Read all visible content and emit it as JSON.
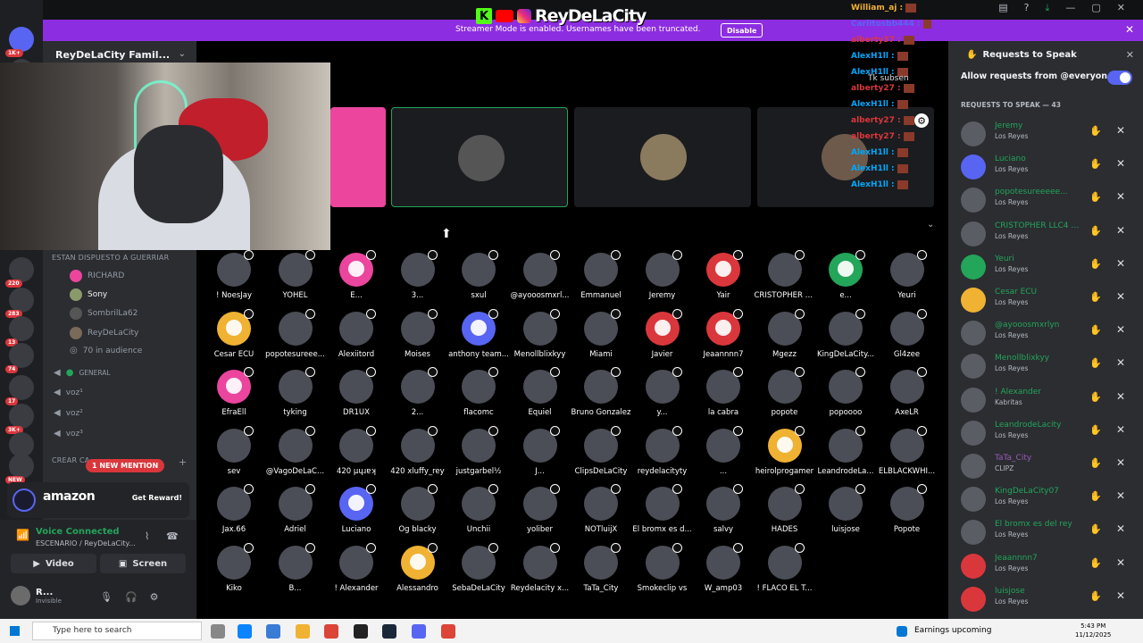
{
  "streamer_banner": {
    "text": "Streamer Mode is enabled. Usernames have been truncated.",
    "button": "Disable"
  },
  "overlay_logo": {
    "k": "K",
    "name": "ReyDeLaCity"
  },
  "chat_overlay": [
    {
      "name": "William_aj",
      "color": "#f0b232"
    },
    {
      "name": "Carlitosbb444",
      "color": "#5865f2"
    },
    {
      "name": "alberty37",
      "color": "#da373c"
    },
    {
      "name": "AlexH1ll",
      "color": "#00a8fc"
    },
    {
      "name": "AlexH1ll",
      "color": "#00a8fc"
    },
    {
      "name": "alberty27",
      "color": "#da373c"
    },
    {
      "name": "AlexH1ll",
      "color": "#00a8fc"
    },
    {
      "name": "alberty27",
      "color": "#da373c"
    },
    {
      "name": "alberty27",
      "color": "#da373c"
    },
    {
      "name": "AlexH1ll",
      "color": "#00a8fc"
    },
    {
      "name": "AlexH1ll",
      "color": "#00a8fc"
    },
    {
      "name": "AlexH1ll",
      "color": "#00a8fc"
    }
  ],
  "chat_tk": "Tk subsen",
  "sidebar": {
    "server_title": "ReyDeLaCity Famil...",
    "server_badges": [
      "1K+",
      "220",
      "283",
      "13",
      "74",
      "17",
      "3K+",
      "NEW"
    ],
    "stage_subtitle": "ESTAN DISPUESTO A GUERRIAR",
    "speakers": [
      "RICHARD",
      "Sony",
      "SombrilLa62",
      "ReyDeLaCity"
    ],
    "audience": "70 in audience",
    "category_general": "GENERAL",
    "voice_channels": [
      "voz¹",
      "voz²",
      "voz³"
    ],
    "crear_label": "CREAR CA",
    "new_mention": "1 NEW MENTION",
    "ad": {
      "brand": "amazon",
      "cta": "Get Reward!"
    },
    "voice": {
      "status": "Voice Connected",
      "channel": "ESCENARIO / ReyDeLaCity...",
      "video": "Video",
      "screen": "Screen"
    },
    "user": {
      "name": "R...",
      "status": "Invisible"
    }
  },
  "stage_tiles": 4,
  "audience_grid": [
    {
      "label": "! NoesJay",
      "kind": "photo"
    },
    {
      "label": "YOHEL",
      "kind": "photo"
    },
    {
      "label": "E...",
      "kind": "pink"
    },
    {
      "label": "3...",
      "kind": "photo"
    },
    {
      "label": "sxul",
      "kind": "photo"
    },
    {
      "label": "@ayooosmxrl...",
      "kind": "photo"
    },
    {
      "label": "Emmanuel",
      "kind": "photo"
    },
    {
      "label": "Jeremy",
      "kind": "photo"
    },
    {
      "label": "Yair",
      "kind": "red"
    },
    {
      "label": "CRISTOPHER LLC...",
      "kind": "photo"
    },
    {
      "label": "e...",
      "kind": "green"
    },
    {
      "label": "Yeuri",
      "kind": "photo"
    },
    {
      "label": "Cesar ECU",
      "kind": "orange"
    },
    {
      "label": "popotesureee...",
      "kind": "photo"
    },
    {
      "label": "Alexiitord",
      "kind": "photo"
    },
    {
      "label": "Moises",
      "kind": "photo"
    },
    {
      "label": "anthony team...",
      "kind": "discord"
    },
    {
      "label": "Menollblixkyy",
      "kind": "photo"
    },
    {
      "label": "Miami",
      "kind": "photo"
    },
    {
      "label": "Javier",
      "kind": "red"
    },
    {
      "label": "Jeaannnn7",
      "kind": "red"
    },
    {
      "label": "Mgezz",
      "kind": "photo"
    },
    {
      "label": "KingDeLaCity...",
      "kind": "photo"
    },
    {
      "label": "Gl4zee",
      "kind": "photo"
    },
    {
      "label": "EfraEll",
      "kind": "pink"
    },
    {
      "label": "tyking",
      "kind": "photo"
    },
    {
      "label": "DR1UX",
      "kind": "photo"
    },
    {
      "label": "2...",
      "kind": "photo"
    },
    {
      "label": "flacomc",
      "kind": "photo"
    },
    {
      "label": "Equiel",
      "kind": "photo"
    },
    {
      "label": "Bruno Gonzalez",
      "kind": "photo"
    },
    {
      "label": "y...",
      "kind": "photo"
    },
    {
      "label": "la cabra",
      "kind": "photo"
    },
    {
      "label": "popote",
      "kind": "photo"
    },
    {
      "label": "popoooo",
      "kind": "photo"
    },
    {
      "label": "AxeLR",
      "kind": "photo"
    },
    {
      "label": "sev",
      "kind": "photo"
    },
    {
      "label": "@VagoDeLaC...",
      "kind": "photo"
    },
    {
      "label": "420 µɥɹɐʞ",
      "kind": "photo"
    },
    {
      "label": "420 xluffy_rey",
      "kind": "photo"
    },
    {
      "label": "justgarbel½",
      "kind": "photo"
    },
    {
      "label": "J...",
      "kind": "photo"
    },
    {
      "label": "ClipsDeLaCity",
      "kind": "photo"
    },
    {
      "label": "reydelacityty",
      "kind": "photo"
    },
    {
      "label": "...",
      "kind": "photo"
    },
    {
      "label": "heirolprogamer",
      "kind": "orange"
    },
    {
      "label": "LeandrodeLa...",
      "kind": "photo"
    },
    {
      "label": "ELBLACKWHI...",
      "kind": "photo"
    },
    {
      "label": "Jax.66",
      "kind": "photo"
    },
    {
      "label": "Adriel",
      "kind": "photo"
    },
    {
      "label": "Luciano",
      "kind": "discord"
    },
    {
      "label": "Og blacky",
      "kind": "photo"
    },
    {
      "label": "Unchii",
      "kind": "photo"
    },
    {
      "label": "yoliber",
      "kind": "photo"
    },
    {
      "label": "NOTluijX",
      "kind": "photo"
    },
    {
      "label": "El bromx es d...",
      "kind": "photo"
    },
    {
      "label": "salvy",
      "kind": "photo"
    },
    {
      "label": "HADES",
      "kind": "photo"
    },
    {
      "label": "luisjose",
      "kind": "photo"
    },
    {
      "label": "Popote",
      "kind": "photo"
    },
    {
      "label": "Kiko",
      "kind": "photo"
    },
    {
      "label": "B...",
      "kind": "photo"
    },
    {
      "label": "! Alexander",
      "kind": "photo"
    },
    {
      "label": "Alessandro",
      "kind": "orange"
    },
    {
      "label": "SebaDeLaCity",
      "kind": "photo"
    },
    {
      "label": "Reydelacity x...",
      "kind": "photo"
    },
    {
      "label": "TaTa_City",
      "kind": "photo"
    },
    {
      "label": "Smokeclip vs",
      "kind": "photo"
    },
    {
      "label": "W_amp03",
      "kind": "photo"
    },
    {
      "label": "! FLACO EL T...",
      "kind": "photo"
    }
  ],
  "requests_panel": {
    "title": "Requests to Speak",
    "allow": "Allow requests from @everyone",
    "section": "REQUESTS TO SPEAK — 43",
    "items": [
      {
        "name": "Jeremy",
        "group": "Los Reyes",
        "kind": "photo"
      },
      {
        "name": "Luciano",
        "group": "Los Reyes",
        "kind": "discord"
      },
      {
        "name": "popotesureeeee...",
        "group": "Los Reyes",
        "kind": "photo"
      },
      {
        "name": "CRISTOPHER LLC4 VE",
        "group": "Los Reyes",
        "kind": "photo"
      },
      {
        "name": "Yeuri",
        "group": "Los Reyes",
        "kind": "green"
      },
      {
        "name": "Cesar ECU",
        "group": "Los Reyes",
        "kind": "orange"
      },
      {
        "name": "@ayooosmxrlyn",
        "group": "Los Reyes",
        "kind": "photo"
      },
      {
        "name": "Menollblixkyy",
        "group": "Los Reyes",
        "kind": "photo"
      },
      {
        "name": "! Alexander",
        "group": "Kabritas",
        "kind": "photo"
      },
      {
        "name": "LeandrodeLacity",
        "group": "Los Reyes",
        "kind": "photo"
      },
      {
        "name": "TaTa_City",
        "group": "CLIPZ",
        "kind": "photo"
      },
      {
        "name": "KingDeLaCity07",
        "group": "Los Reyes",
        "kind": "photo"
      },
      {
        "name": "El bromx es del rey",
        "group": "Los Reyes",
        "kind": "photo"
      },
      {
        "name": "Jeaannnn7",
        "group": "Los Reyes",
        "kind": "red"
      },
      {
        "name": "luisjose",
        "group": "Los Reyes",
        "kind": "red"
      }
    ]
  },
  "taskbar": {
    "search": "Type here to search",
    "weather": "Earnings upcoming",
    "time": "5:43 PM",
    "date": "11/12/2025"
  },
  "colors": {
    "blurple": "#5865f2",
    "green": "#23a55a",
    "red": "#da373c",
    "banner": "#8d2de1"
  }
}
